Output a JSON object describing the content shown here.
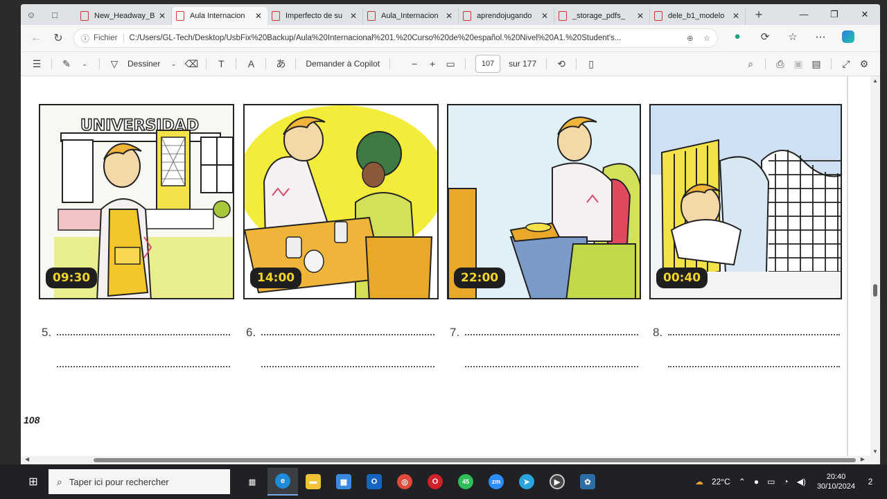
{
  "browser": {
    "tabs": [
      {
        "label": "New_Headway_B",
        "active": false
      },
      {
        "label": "Aula Internacion",
        "active": true
      },
      {
        "label": "Imperfecto de su",
        "active": false
      },
      {
        "label": "Aula_Internacion",
        "active": false
      },
      {
        "label": "aprendojugando",
        "active": false
      },
      {
        "label": "_storage_pdfs_",
        "active": false
      },
      {
        "label": "dele_b1_modelo",
        "active": false
      }
    ],
    "address": {
      "scheme_label": "Fichier",
      "url": "C:/Users/GL-Tech/Desktop/UsbFix%20Backup/Aula%20Internacional%201.%20Curso%20de%20español.%20Nivel%20A1.%20Student's..."
    }
  },
  "pdf_toolbar": {
    "draw_label": "Dessiner",
    "copilot_label": "Demander à Copilot",
    "current_page": "107",
    "total_pages": "sur 177"
  },
  "page": {
    "panels": [
      {
        "time": "09:30",
        "sign": "UNIVERSIDAD"
      },
      {
        "time": "14:00"
      },
      {
        "time": "22:00"
      },
      {
        "time": "00:40"
      }
    ],
    "exercises": [
      "5.",
      "6.",
      "7.",
      "8."
    ],
    "page_number": "108"
  },
  "taskbar": {
    "search_placeholder": "Taper ici pour rechercher",
    "whatsapp_badge": "45",
    "weather": "22°C",
    "time": "20:40",
    "date": "30/10/2024",
    "notifications": "2"
  }
}
